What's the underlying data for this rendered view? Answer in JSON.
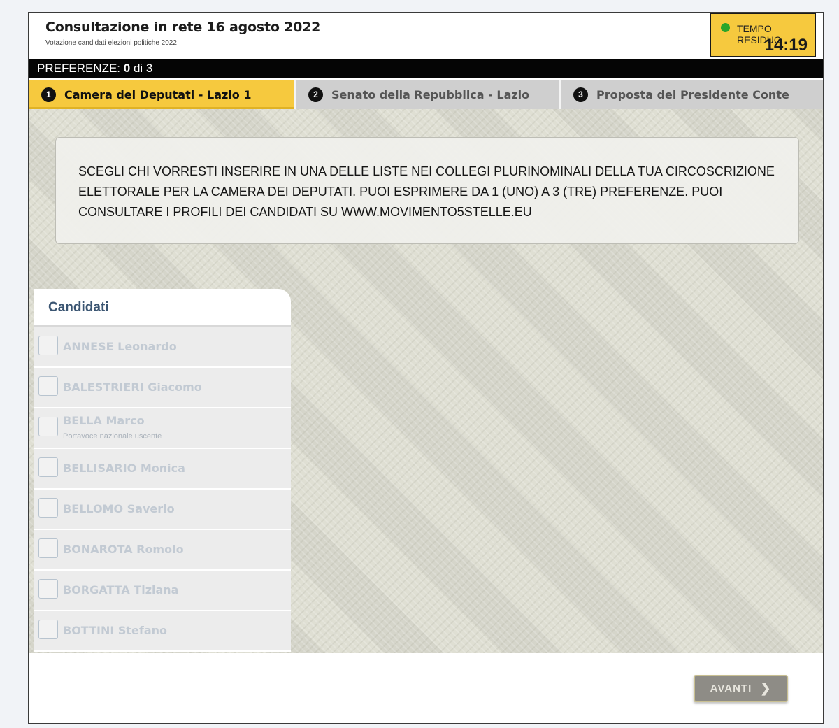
{
  "header": {
    "title": "Consultazione in rete 16 agosto 2022",
    "subtitle": "Votazione candidati elezioni politiche 2022"
  },
  "timer": {
    "label": "TEMPO RESIDUO",
    "value": "14:19",
    "status_color": "#2aa52a"
  },
  "preferences": {
    "label": "PREFERENZE:",
    "count": "0",
    "of": "di 3"
  },
  "tabs": [
    {
      "number": "1",
      "label": "Camera dei Deputati - Lazio 1",
      "active": true
    },
    {
      "number": "2",
      "label": "Senato della Repubblica - Lazio",
      "active": false
    },
    {
      "number": "3",
      "label": "Proposta del Presidente Conte",
      "active": false
    }
  ],
  "instructions": {
    "text": "SCEGLI CHI VORRESTI INSERIRE IN UNA DELLE LISTE NEI COLLEGI PLURINOMINALI DELLA TUA CIRCOSCRIZIONE ELETTORALE PER LA CAMERA DEI DEPUTATI. PUOI ESPRIMERE DA 1 (UNO) A 3 (TRE) PREFERENZE. PUOI CONSULTARE I PROFILI DEI CANDIDATI SU WWW.MOVIMENTO5STELLE.EU"
  },
  "candidates": {
    "title": "Candidati",
    "items": [
      {
        "name": "ANNESE Leonardo",
        "note": ""
      },
      {
        "name": "BALESTRIERI Giacomo",
        "note": ""
      },
      {
        "name": "BELLA Marco",
        "note": "Portavoce nazionale uscente"
      },
      {
        "name": "BELLISARIO Monica",
        "note": ""
      },
      {
        "name": "BELLOMO Saverio",
        "note": ""
      },
      {
        "name": "BONAROTA Romolo",
        "note": ""
      },
      {
        "name": "BORGATTA Tiziana",
        "note": ""
      },
      {
        "name": "BOTTINI Stefano",
        "note": ""
      }
    ]
  },
  "footer": {
    "next_label": "AVANTI",
    "next_icon": "chevron-right-icon"
  },
  "colors": {
    "accent": "#f6c93e",
    "header_bar": "#050505",
    "candidate_title": "#3a5572"
  }
}
